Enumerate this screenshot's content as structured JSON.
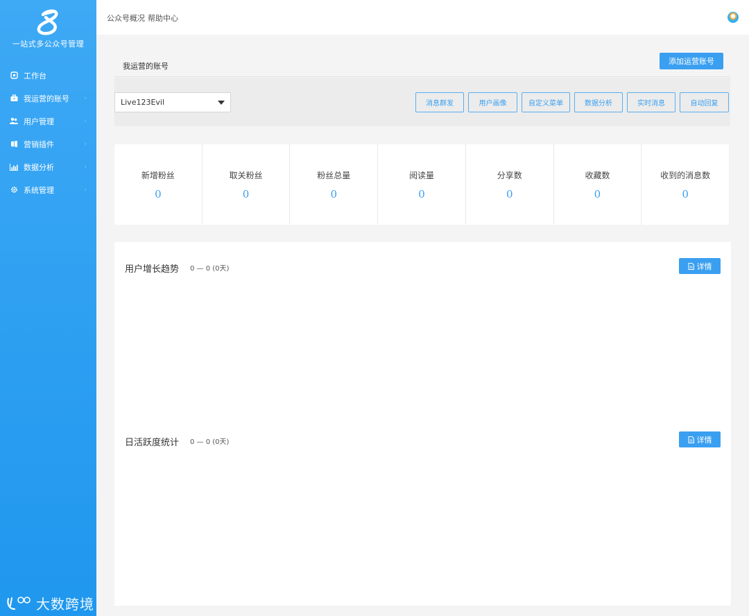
{
  "sidebar": {
    "logo_text": "一站式多公众号管理",
    "items": [
      {
        "label": "工作台",
        "icon": "dashboard-icon"
      },
      {
        "label": "我运营的账号",
        "icon": "briefcase-icon"
      },
      {
        "label": "用户管理",
        "icon": "users-icon"
      },
      {
        "label": "营销插件",
        "icon": "plugin-icon"
      },
      {
        "label": "数据分析",
        "icon": "bar-chart-icon"
      },
      {
        "label": "系统管理",
        "icon": "gear-icon"
      }
    ],
    "watermark": "大数跨境"
  },
  "topbar": {
    "breadcrumb": [
      "公众号概况",
      "帮助中心"
    ],
    "avatar_icon": "avatar-icon"
  },
  "account_panel": {
    "title": "我运营的账号",
    "add_button": "添加运营账号",
    "selected_account": "Live123Evil",
    "actions": [
      "消息群发",
      "用户画像",
      "自定义菜单",
      "数据分析",
      "实时消息",
      "自动回复"
    ]
  },
  "stats": [
    {
      "label": "新增粉丝",
      "value": "0"
    },
    {
      "label": "取关粉丝",
      "value": "0"
    },
    {
      "label": "粉丝总量",
      "value": "0"
    },
    {
      "label": "阅读量",
      "value": "0"
    },
    {
      "label": "分享数",
      "value": "0"
    },
    {
      "label": "收藏数",
      "value": "0"
    },
    {
      "label": "收到的消息数",
      "value": "0"
    }
  ],
  "sections": [
    {
      "title": "用户增长趋势",
      "range": "0 — 0 (0天)",
      "button": "详情"
    },
    {
      "title": "日活跃度统计",
      "range": "0 — 0 (0天)",
      "button": "详情"
    }
  ],
  "colors": {
    "accent": "#3a9ff0",
    "sidebar": "#2a9ff2",
    "background": "#f4f4f4"
  }
}
